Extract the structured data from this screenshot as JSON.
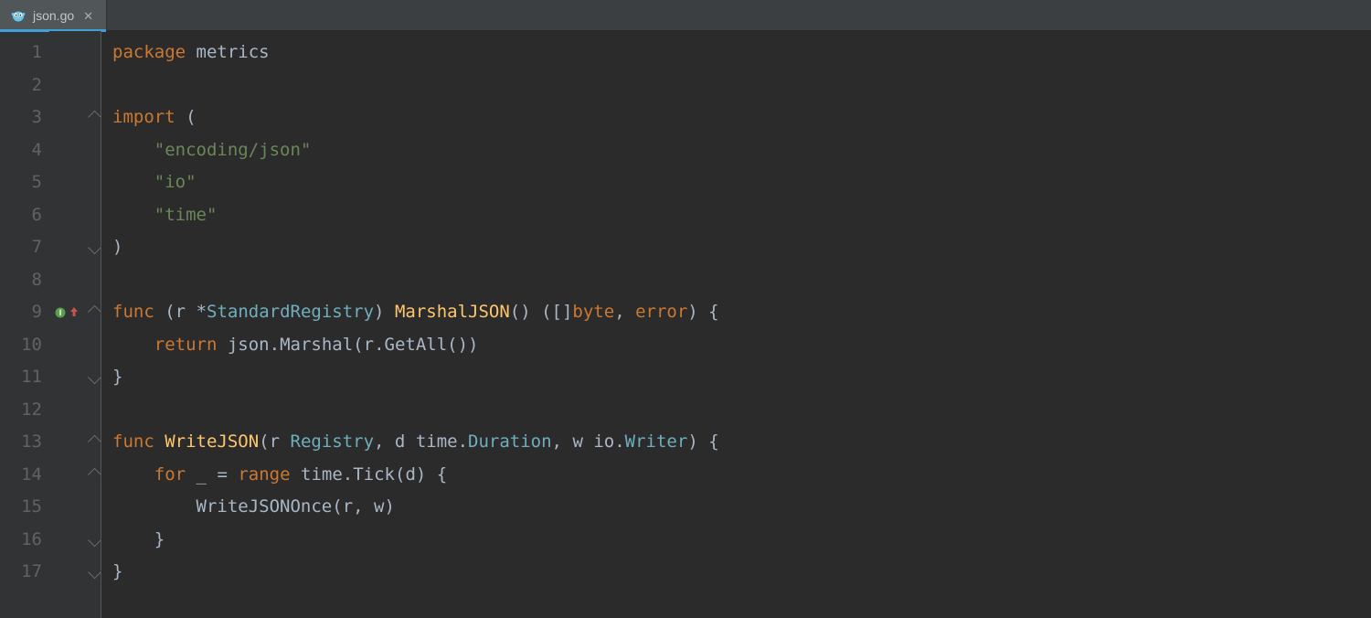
{
  "tab": {
    "filename": "json.go"
  },
  "gutter": {
    "line_numbers": [
      "1",
      "2",
      "3",
      "4",
      "5",
      "6",
      "7",
      "8",
      "9",
      "10",
      "11",
      "12",
      "13",
      "14",
      "15",
      "16",
      "17"
    ]
  },
  "code": {
    "lines": [
      {
        "n": 1,
        "tokens": [
          [
            "kw",
            "package"
          ],
          [
            "sp",
            " "
          ],
          [
            "ident",
            "metrics"
          ]
        ]
      },
      {
        "n": 2,
        "tokens": []
      },
      {
        "n": 3,
        "tokens": [
          [
            "kw",
            "import"
          ],
          [
            "sp",
            " "
          ],
          [
            "punc",
            "("
          ]
        ]
      },
      {
        "n": 4,
        "tokens": [
          [
            "sp",
            "    "
          ],
          [
            "str",
            "\"encoding/json\""
          ]
        ]
      },
      {
        "n": 5,
        "tokens": [
          [
            "sp",
            "    "
          ],
          [
            "str",
            "\"io\""
          ]
        ]
      },
      {
        "n": 6,
        "tokens": [
          [
            "sp",
            "    "
          ],
          [
            "str",
            "\"time\""
          ]
        ]
      },
      {
        "n": 7,
        "tokens": [
          [
            "punc",
            ")"
          ]
        ]
      },
      {
        "n": 8,
        "tokens": []
      },
      {
        "n": 9,
        "tokens": [
          [
            "kw",
            "func"
          ],
          [
            "sp",
            " "
          ],
          [
            "punc",
            "("
          ],
          [
            "ident",
            "r "
          ],
          [
            "op",
            "*"
          ],
          [
            "type",
            "StandardRegistry"
          ],
          [
            "punc",
            ") "
          ],
          [
            "fn",
            "MarshalJSON"
          ],
          [
            "punc",
            "() ([]"
          ],
          [
            "kw",
            "byte"
          ],
          [
            "punc",
            ", "
          ],
          [
            "kw",
            "error"
          ],
          [
            "punc",
            ") {"
          ]
        ]
      },
      {
        "n": 10,
        "tokens": [
          [
            "sp",
            "    "
          ],
          [
            "kw",
            "return"
          ],
          [
            "sp",
            " "
          ],
          [
            "ident",
            "json"
          ],
          [
            "punc",
            "."
          ],
          [
            "ident",
            "Marshal"
          ],
          [
            "punc",
            "("
          ],
          [
            "ident",
            "r"
          ],
          [
            "punc",
            "."
          ],
          [
            "ident",
            "GetAll"
          ],
          [
            "punc",
            "())"
          ]
        ]
      },
      {
        "n": 11,
        "tokens": [
          [
            "punc",
            "}"
          ]
        ]
      },
      {
        "n": 12,
        "tokens": []
      },
      {
        "n": 13,
        "tokens": [
          [
            "kw",
            "func"
          ],
          [
            "sp",
            " "
          ],
          [
            "fn",
            "WriteJSON"
          ],
          [
            "punc",
            "("
          ],
          [
            "ident",
            "r "
          ],
          [
            "type",
            "Registry"
          ],
          [
            "punc",
            ", "
          ],
          [
            "ident",
            "d "
          ],
          [
            "ident",
            "time"
          ],
          [
            "punc",
            "."
          ],
          [
            "type",
            "Duration"
          ],
          [
            "punc",
            ", "
          ],
          [
            "ident",
            "w "
          ],
          [
            "ident",
            "io"
          ],
          [
            "punc",
            "."
          ],
          [
            "type",
            "Writer"
          ],
          [
            "punc",
            ") {"
          ]
        ]
      },
      {
        "n": 14,
        "tokens": [
          [
            "sp",
            "    "
          ],
          [
            "kw",
            "for"
          ],
          [
            "sp",
            " "
          ],
          [
            "ident",
            "_"
          ],
          [
            "sp",
            " "
          ],
          [
            "punc",
            "="
          ],
          [
            "sp",
            " "
          ],
          [
            "kw",
            "range"
          ],
          [
            "sp",
            " "
          ],
          [
            "ident",
            "time"
          ],
          [
            "punc",
            "."
          ],
          [
            "ident",
            "Tick"
          ],
          [
            "punc",
            "("
          ],
          [
            "ident",
            "d"
          ],
          [
            "punc",
            ") {"
          ]
        ]
      },
      {
        "n": 15,
        "tokens": [
          [
            "sp",
            "        "
          ],
          [
            "ident",
            "WriteJSONOnce"
          ],
          [
            "punc",
            "("
          ],
          [
            "ident",
            "r"
          ],
          [
            "punc",
            ", "
          ],
          [
            "ident",
            "w"
          ],
          [
            "punc",
            ")"
          ]
        ]
      },
      {
        "n": 16,
        "tokens": [
          [
            "sp",
            "    "
          ],
          [
            "punc",
            "}"
          ]
        ]
      },
      {
        "n": 17,
        "tokens": [
          [
            "punc",
            "}"
          ]
        ]
      }
    ]
  },
  "fold_markers": [
    {
      "line": 3,
      "kind": "start"
    },
    {
      "line": 7,
      "kind": "end"
    },
    {
      "line": 9,
      "kind": "start"
    },
    {
      "line": 11,
      "kind": "end"
    },
    {
      "line": 13,
      "kind": "start"
    },
    {
      "line": 14,
      "kind": "start"
    },
    {
      "line": 16,
      "kind": "end"
    },
    {
      "line": 17,
      "kind": "end"
    }
  ],
  "gutter_icons": [
    {
      "line": 9,
      "name": "implements-marker"
    }
  ],
  "colors": {
    "bg": "#2b2b2b",
    "gutter": "#313335",
    "accent": "#40a0d8"
  }
}
